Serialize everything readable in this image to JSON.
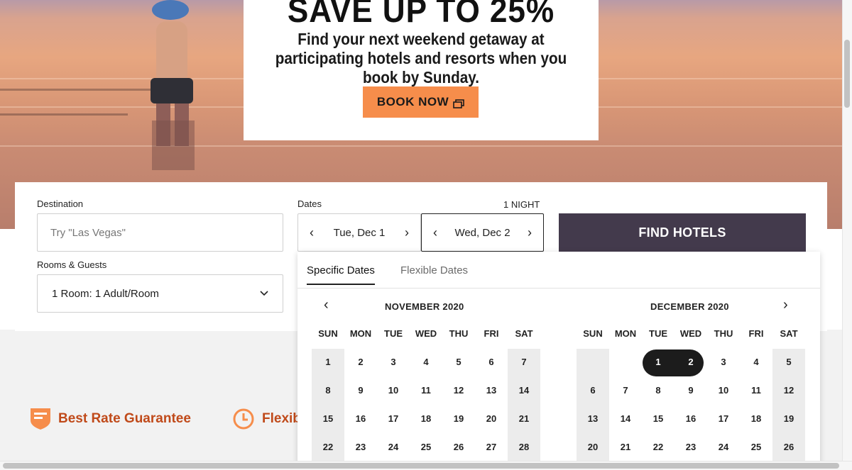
{
  "hero": {
    "headline": "SAVE UP TO 25%",
    "subtext": "Find your next weekend getaway at participating hotels and resorts when you book by Sunday.",
    "book_button": "BOOK NOW"
  },
  "search": {
    "destination_label": "Destination",
    "destination_placeholder": "Try \"Las Vegas\"",
    "dates_label": "Dates",
    "nights_label": "1 NIGHT",
    "check_in": "Tue, Dec 1",
    "check_out": "Wed, Dec 2",
    "rooms_label": "Rooms & Guests",
    "rooms_value": "1 Room: 1 Adult/Room",
    "find_button": "FIND HOTELS"
  },
  "features": [
    {
      "label": "Best Rate Guarantee",
      "icon": "shield-icon"
    },
    {
      "label": "Flexib",
      "icon": "clock-icon"
    }
  ],
  "calendar": {
    "tabs": [
      "Specific Dates",
      "Flexible Dates"
    ],
    "active_tab": "Specific Dates",
    "weekdays": [
      "SUN",
      "MON",
      "TUE",
      "WED",
      "THU",
      "FRI",
      "SAT"
    ],
    "months": [
      {
        "title": "NOVEMBER 2020",
        "first_weekday": 0,
        "days": [
          "1",
          "2",
          "3",
          "4",
          "5",
          "6",
          "7",
          "8",
          "9",
          "10",
          "11",
          "12",
          "13",
          "14",
          "15",
          "16",
          "17",
          "18",
          "19",
          "20",
          "21",
          "22",
          "23",
          "24",
          "25",
          "26",
          "27",
          "28"
        ]
      },
      {
        "title": "DECEMBER 2020",
        "first_weekday": 2,
        "days": [
          "1",
          "2",
          "3",
          "4",
          "5",
          "6",
          "7",
          "8",
          "9",
          "10",
          "11",
          "12",
          "13",
          "14",
          "15",
          "16",
          "17",
          "18",
          "19",
          "20",
          "21",
          "22",
          "23",
          "24",
          "25",
          "26"
        ]
      }
    ],
    "selected_days": [
      "1",
      "2"
    ]
  },
  "colors": {
    "accent": "#f68d4b",
    "find_button": "#433a4c",
    "feature_text": "#c04a1a"
  }
}
